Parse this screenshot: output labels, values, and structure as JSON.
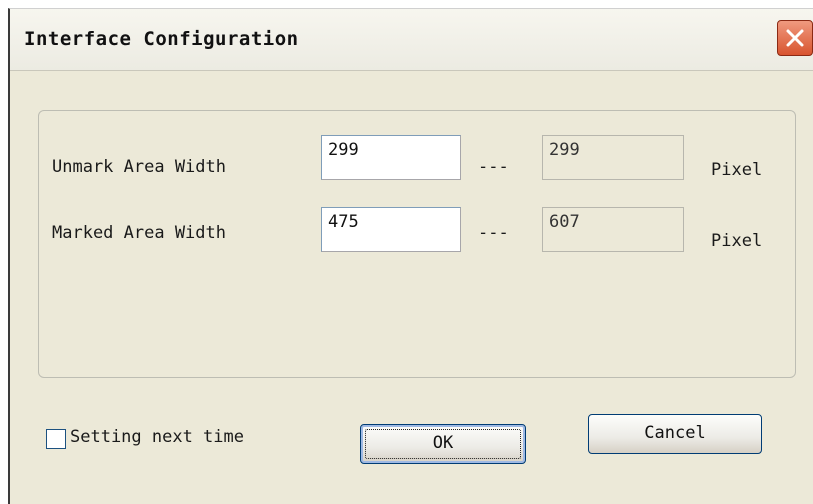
{
  "window": {
    "title": "Interface Configuration",
    "close_icon": "close-icon"
  },
  "settings": {
    "rows": [
      {
        "label": "Unmark Area Width",
        "input_value": "299",
        "separator": "---",
        "readonly_value": "299",
        "unit": "Pixel"
      },
      {
        "label": "Marked Area Width",
        "input_value": "475",
        "separator": "---",
        "readonly_value": "607",
        "unit": "Pixel"
      }
    ]
  },
  "footer": {
    "checkbox_label": "Setting next time",
    "checkbox_checked": false,
    "ok_label": "OK",
    "cancel_label": "Cancel"
  },
  "colors": {
    "dialog_background": "#ece9d8",
    "close_button": "#d8542f",
    "button_border": "#003c74"
  }
}
